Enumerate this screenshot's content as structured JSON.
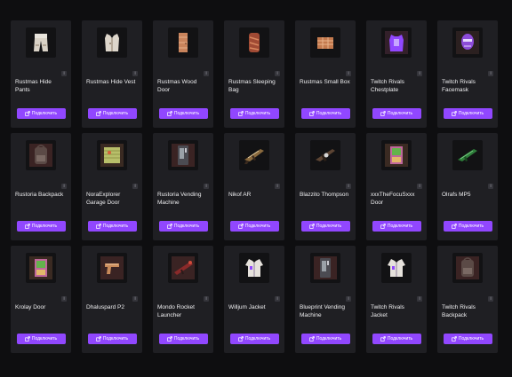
{
  "button_label": "Подключить",
  "info_glyph": "i",
  "accent_color": "#9147ff",
  "items": [
    {
      "name": "Rustmas Hide Pants",
      "icon": "hide-pants-icon"
    },
    {
      "name": "Rustmas Hide Vest",
      "icon": "hide-vest-icon"
    },
    {
      "name": "Rustmas Wood Door",
      "icon": "wood-door-icon"
    },
    {
      "name": "Rustmas Sleeping Bag",
      "icon": "sleeping-bag-icon"
    },
    {
      "name": "Rustmas Small Box",
      "icon": "small-box-icon"
    },
    {
      "name": "Twitch Rivals Chestplate",
      "icon": "chestplate-icon"
    },
    {
      "name": "Twitch Rivals Facemask",
      "icon": "facemask-icon"
    },
    {
      "name": "Rustoria Backpack",
      "icon": "backpack-icon"
    },
    {
      "name": "NoraExplorer Garage Door",
      "icon": "garage-door-icon"
    },
    {
      "name": "Rustoria Vending Machine",
      "icon": "vending-machine-icon"
    },
    {
      "name": "Nikof AR",
      "icon": "assault-rifle-icon"
    },
    {
      "name": "Blazzito Thompson",
      "icon": "thompson-icon"
    },
    {
      "name": "xxxTheFocuSxxx Door",
      "icon": "door-icon"
    },
    {
      "name": "Olrafs MP5",
      "icon": "mp5-icon"
    },
    {
      "name": "Krolay Door",
      "icon": "door-icon"
    },
    {
      "name": "Dhaluspard P2",
      "icon": "pistol-icon"
    },
    {
      "name": "Mondo Rocket Launcher",
      "icon": "rocket-launcher-icon"
    },
    {
      "name": "Willjum Jacket",
      "icon": "jacket-icon"
    },
    {
      "name": "Blueprint Vending Machine",
      "icon": "vending-machine-icon"
    },
    {
      "name": "Twitch Rivals Jacket",
      "icon": "jacket-icon"
    },
    {
      "name": "Twitch Rivals Backpack",
      "icon": "backpack-icon"
    }
  ]
}
